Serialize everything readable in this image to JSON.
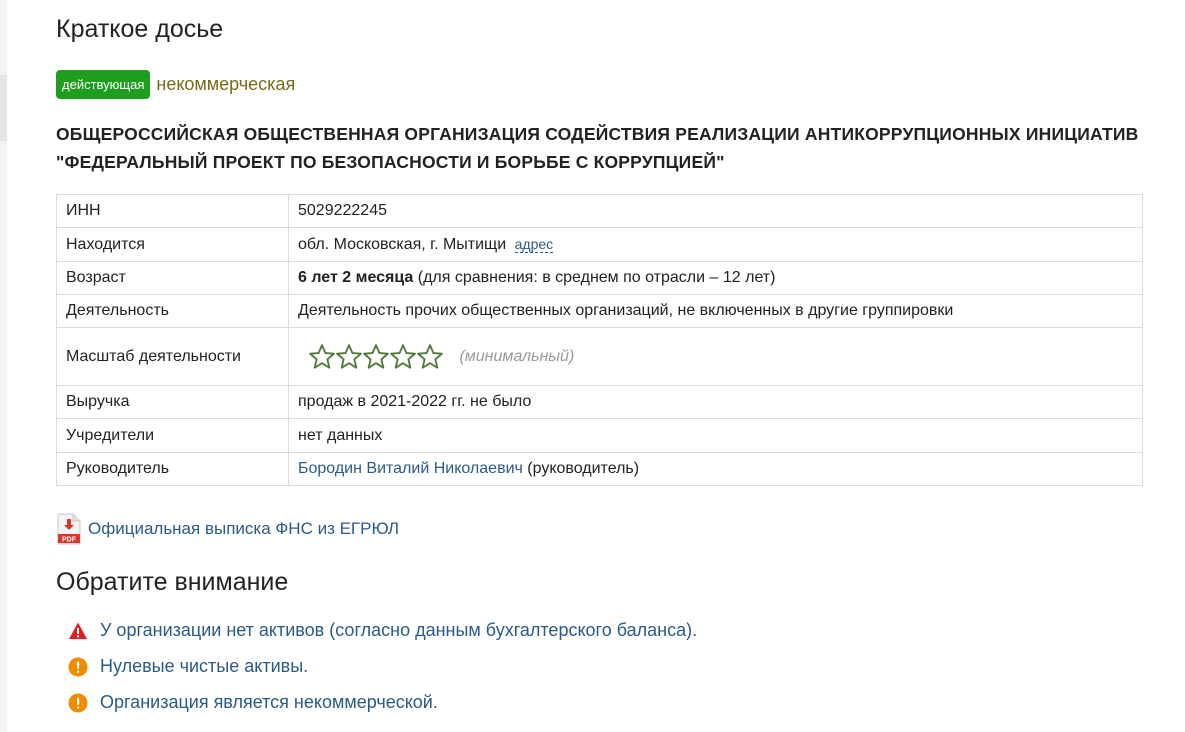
{
  "page": {
    "title": "Краткое досье"
  },
  "status": {
    "badge": "действующая",
    "kind": "некоммерческая"
  },
  "organization": {
    "name": "ОБЩЕРОССИЙСКАЯ ОБЩЕСТВЕННАЯ ОРГАНИЗАЦИЯ СОДЕЙСТВИЯ РЕАЛИЗАЦИИ АНТИКОРРУПЦИОННЫХ ИНИЦИАТИВ \"ФЕДЕРАЛЬНЫЙ ПРОЕКТ ПО БЕЗОПАСНОСТИ И БОРЬБЕ С КОРРУПЦИЕЙ\""
  },
  "info": {
    "inn": {
      "label": "ИНН",
      "value": "5029222245"
    },
    "location": {
      "label": "Находится",
      "value": "обл. Московская, г. Мытищи",
      "link": "адрес"
    },
    "age": {
      "label": "Возраст",
      "value_bold": "6 лет 2 месяца",
      "value_rest": " (для сравнения: в среднем по отрасли – 12 лет)"
    },
    "activity": {
      "label": "Деятельность",
      "value": "Деятельность прочих общественных организаций, не включенных в другие группировки"
    },
    "scale": {
      "label": "Масштаб деятельности",
      "stars_total": 5,
      "stars_filled": 0,
      "text": "(минимальный)"
    },
    "revenue": {
      "label": "Выручка",
      "value": "продаж в 2021-2022 гг. не было"
    },
    "founders": {
      "label": "Учредители",
      "value": "нет данных"
    },
    "head": {
      "label": "Руководитель",
      "name": "Бородин Виталий Николаевич",
      "role": " (руководитель)"
    }
  },
  "pdf": {
    "icon_text": "PDF",
    "link": "Официальная выписка ФНС из ЕГРЮЛ"
  },
  "attention": {
    "title": "Обратите внимание",
    "items": [
      {
        "icon": "warning-triangle-icon",
        "text": "У организации нет активов (согласно данным бухгалтерского баланса)."
      },
      {
        "icon": "exclamation-circle-icon",
        "text": "Нулевые чистые активы."
      },
      {
        "icon": "exclamation-circle-icon",
        "text": "Организация является некоммерческой."
      }
    ]
  },
  "colors": {
    "badge": "#1e9d1e",
    "kind": "#7a6a16",
    "link": "#2a5a8a",
    "warning_red": "#e02020",
    "warning_orange": "#f08c00",
    "star_stroke": "#4f7a3a"
  }
}
